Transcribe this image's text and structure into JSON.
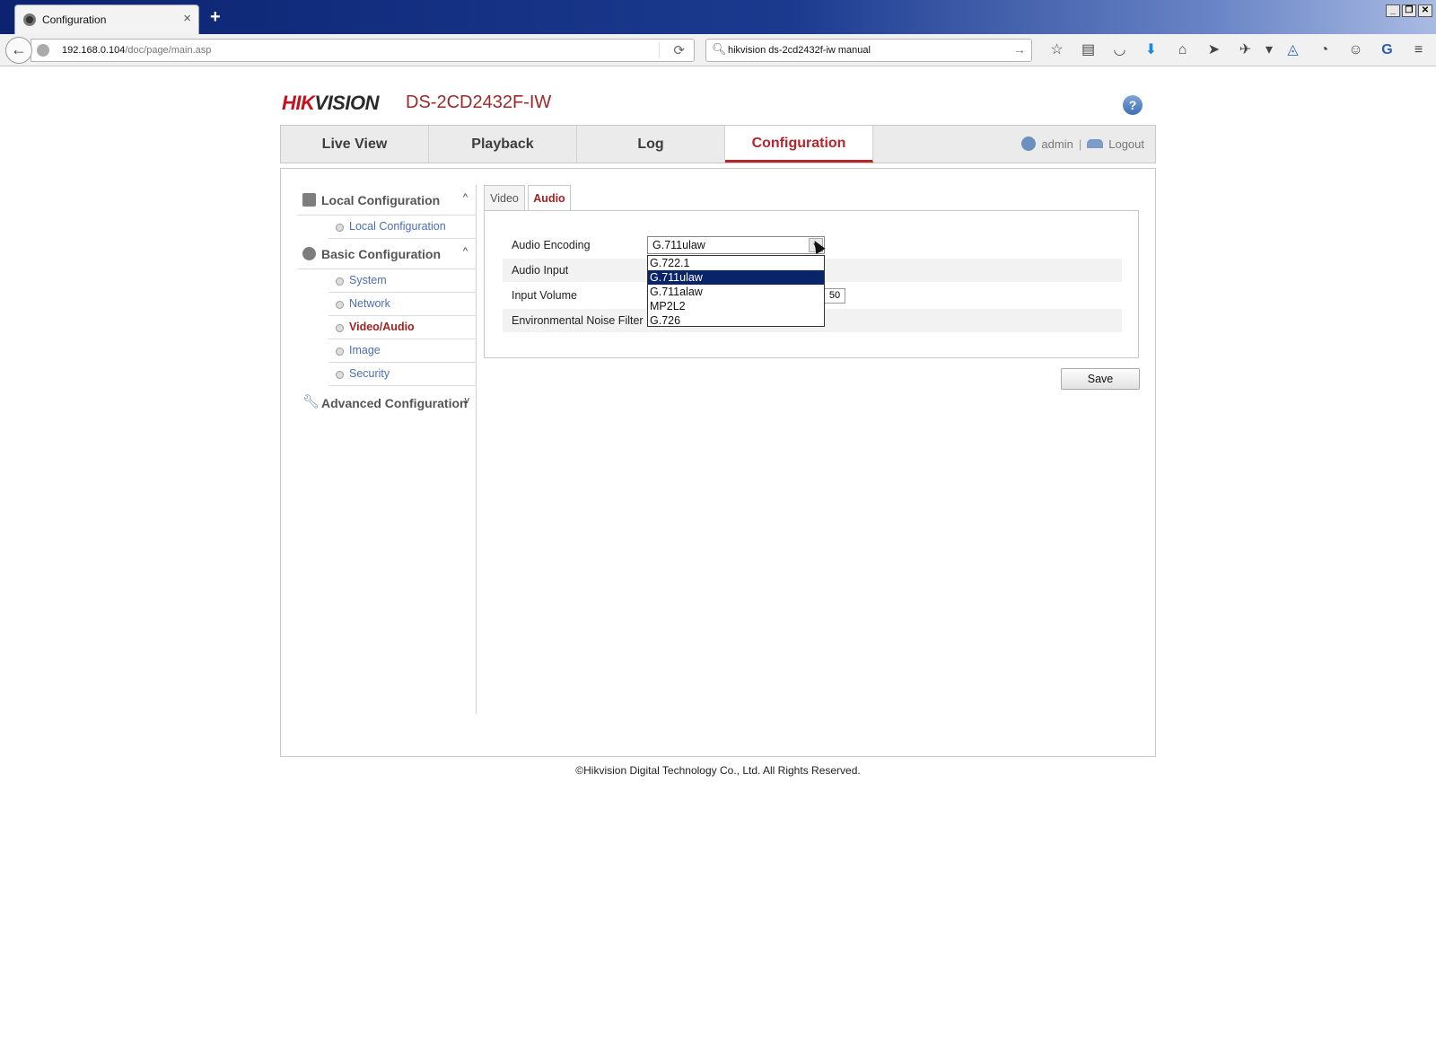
{
  "browser": {
    "tab_title": "Configuration",
    "tab_close": "×",
    "new_tab": "+",
    "url_host": "192.168.0.104",
    "url_path": "/doc/page/main.asp",
    "search_text": "hikvision ds-2cd2432f-iw manual",
    "window_buttons": [
      "_",
      "❐",
      "✕"
    ],
    "toolbar_icons": [
      "star-icon",
      "reading-list-icon",
      "pocket-icon",
      "download-icon",
      "home-icon",
      "send-icon",
      "extension-icon",
      "dropdown-icon",
      "sync-icon",
      "history-icon",
      "chat-icon",
      "g-icon",
      "menu-icon"
    ]
  },
  "header": {
    "logo_red": "HIK",
    "logo_dark": "VISION",
    "model": "DS-2CD2432F-IW",
    "help": "?"
  },
  "nav": {
    "tabs": [
      "Live View",
      "Playback",
      "Log",
      "Configuration"
    ],
    "active_tab": "Configuration",
    "user": "admin",
    "separator": "|",
    "logout": "Logout"
  },
  "sidebar": {
    "groups": [
      {
        "label": "Local Configuration",
        "chevron": "^",
        "items": [
          "Local Configuration"
        ]
      },
      {
        "label": "Basic Configuration",
        "chevron": "^",
        "items": [
          "System",
          "Network",
          "Video/Audio",
          "Image",
          "Security"
        ]
      },
      {
        "label": "Advanced Configuration",
        "chevron": "v",
        "items": []
      }
    ],
    "active_item": "Video/Audio"
  },
  "subtabs": [
    "Video",
    "Audio"
  ],
  "active_subtab": "Audio",
  "form": {
    "audio_encoding_label": "Audio Encoding",
    "audio_encoding_value": "G.711ulaw",
    "audio_input_label": "Audio Input",
    "input_volume_label": "Input Volume",
    "input_volume_value": "50",
    "noise_filter_label": "Environmental Noise Filter",
    "encoding_options": [
      "G.722.1",
      "G.711ulaw",
      "G.711alaw",
      "MP2L2",
      "G.726"
    ],
    "selected_option": "G.711ulaw"
  },
  "save_label": "Save",
  "footer": "©Hikvision Digital Technology Co., Ltd. All Rights Reserved."
}
